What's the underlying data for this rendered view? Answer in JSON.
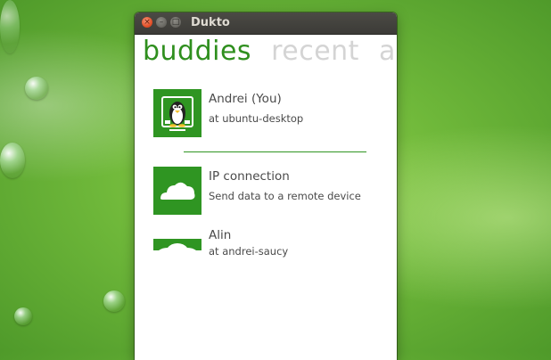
{
  "window": {
    "title": "Dukto",
    "controls": {
      "close": "×",
      "minimize": "–",
      "maximize": "□"
    }
  },
  "tabs": [
    {
      "label": "buddies",
      "active": true
    },
    {
      "label": "recent",
      "active": false
    },
    {
      "label": "about",
      "active": false
    }
  ],
  "buddies": [
    {
      "name": "Andrei (You)",
      "subtitle": "at ubuntu-desktop",
      "icon": "tux-icon"
    },
    {
      "name": "IP connection",
      "subtitle": "Send data to a remote device",
      "icon": "cloud-icon"
    },
    {
      "name": "Alin",
      "subtitle": "at andrei-saucy",
      "icon": "cloud-icon"
    }
  ],
  "colors": {
    "accent": "#2f9522",
    "tab_active": "#2f8f1e",
    "tab_inactive": "#d4d4d4",
    "titlebar": "#3c3b37"
  }
}
